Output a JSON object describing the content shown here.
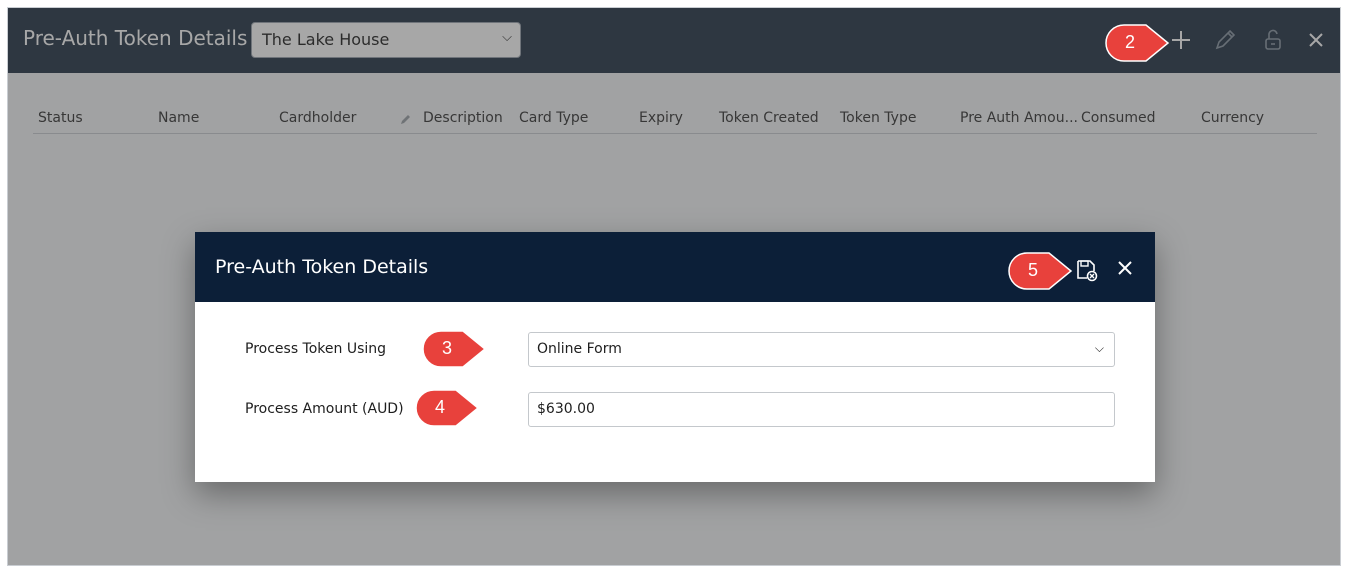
{
  "header": {
    "title": "Pre-Auth Token Details",
    "property_select": {
      "value": "The Lake House"
    }
  },
  "toolbar": {
    "icons": [
      "plus-icon",
      "pencil-icon",
      "unlock-icon",
      "close-icon"
    ]
  },
  "table": {
    "columns": [
      "Status",
      "Name",
      "Cardholder",
      "Description",
      "Card Type",
      "Expiry",
      "Token Created",
      "Token Type",
      "Pre Auth Amou...",
      "Consumed",
      "Currency"
    ]
  },
  "modal": {
    "title": "Pre-Auth Token Details",
    "fields": [
      {
        "label": "Process Token Using",
        "value": "Online Form",
        "type": "select"
      },
      {
        "label": "Process Amount (AUD)",
        "value": "$630.00",
        "type": "input"
      }
    ]
  },
  "callouts": [
    "2",
    "3",
    "4",
    "5"
  ],
  "colors": {
    "topbar": "#233345",
    "modal_header": "#0c1f38",
    "callout": "#e8413c"
  }
}
